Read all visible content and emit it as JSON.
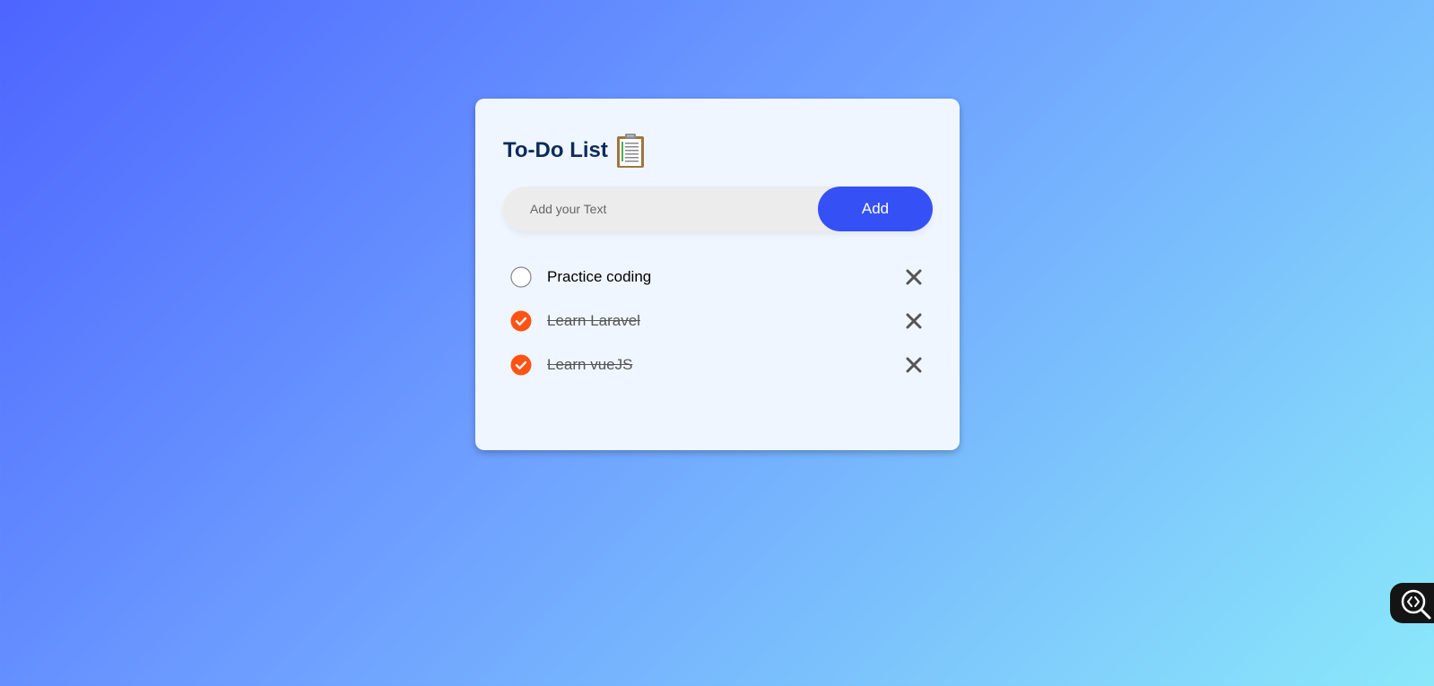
{
  "app": {
    "title": "To-Do List",
    "title_icon": "clipboard-icon"
  },
  "input": {
    "placeholder": "Add your Text",
    "value": "",
    "add_label": "Add"
  },
  "tasks": [
    {
      "text": "Practice coding",
      "done": false
    },
    {
      "text": "Learn Laravel",
      "done": true
    },
    {
      "text": "Learn vueJS",
      "done": true
    }
  ],
  "colors": {
    "accent": "#3551f6",
    "check": "#ff5316",
    "title": "#0d2a5c"
  },
  "floating": {
    "icon": "code-search-icon"
  }
}
